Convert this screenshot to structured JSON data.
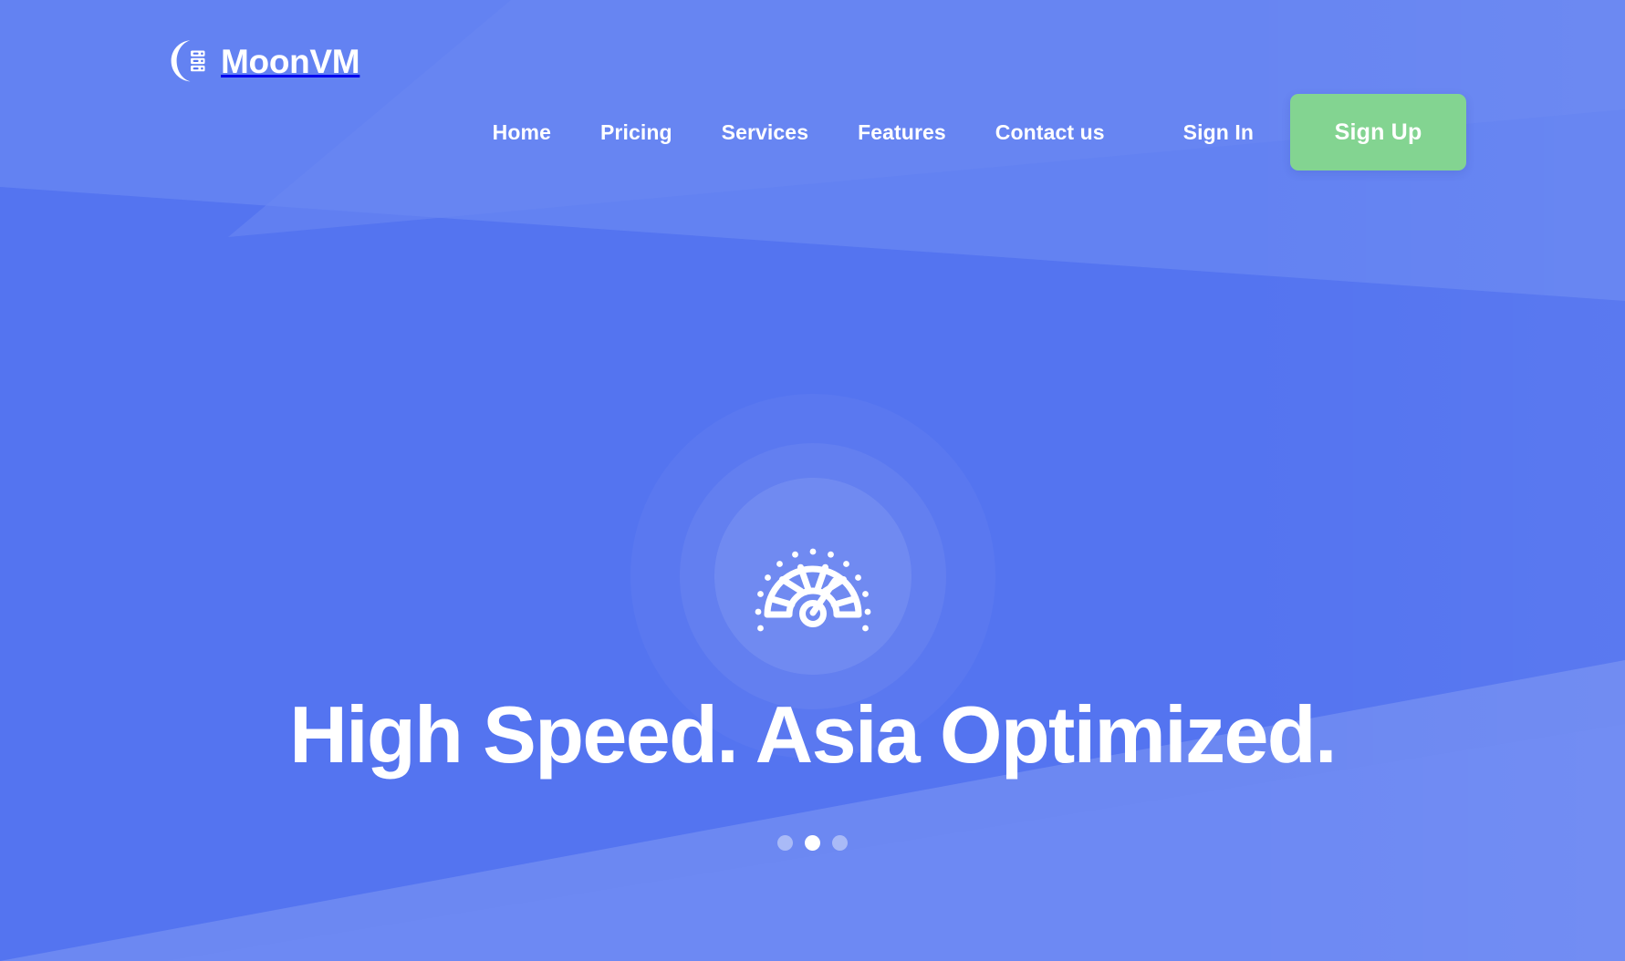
{
  "brand": {
    "name": "MoonVM",
    "icon": "moon-server-icon"
  },
  "nav": {
    "links": [
      {
        "label": "Home",
        "name": "nav-link-home"
      },
      {
        "label": "Pricing",
        "name": "nav-link-pricing"
      },
      {
        "label": "Services",
        "name": "nav-link-services"
      },
      {
        "label": "Features",
        "name": "nav-link-features"
      },
      {
        "label": "Contact us",
        "name": "nav-link-contact-us"
      }
    ],
    "sign_in": "Sign In",
    "sign_up": "Sign Up"
  },
  "hero": {
    "headline": "High Speed. Asia Optimized.",
    "icon": "speedometer-icon",
    "carousel": {
      "slides": 3,
      "active_index": 1
    }
  },
  "colors": {
    "background_blue": "#5474F0",
    "background_blue_light": "#6382F2",
    "signup_green": "#83D491",
    "text_white": "#FFFFFF",
    "dot_inactive": "rgba(255,255,255,0.42)"
  }
}
